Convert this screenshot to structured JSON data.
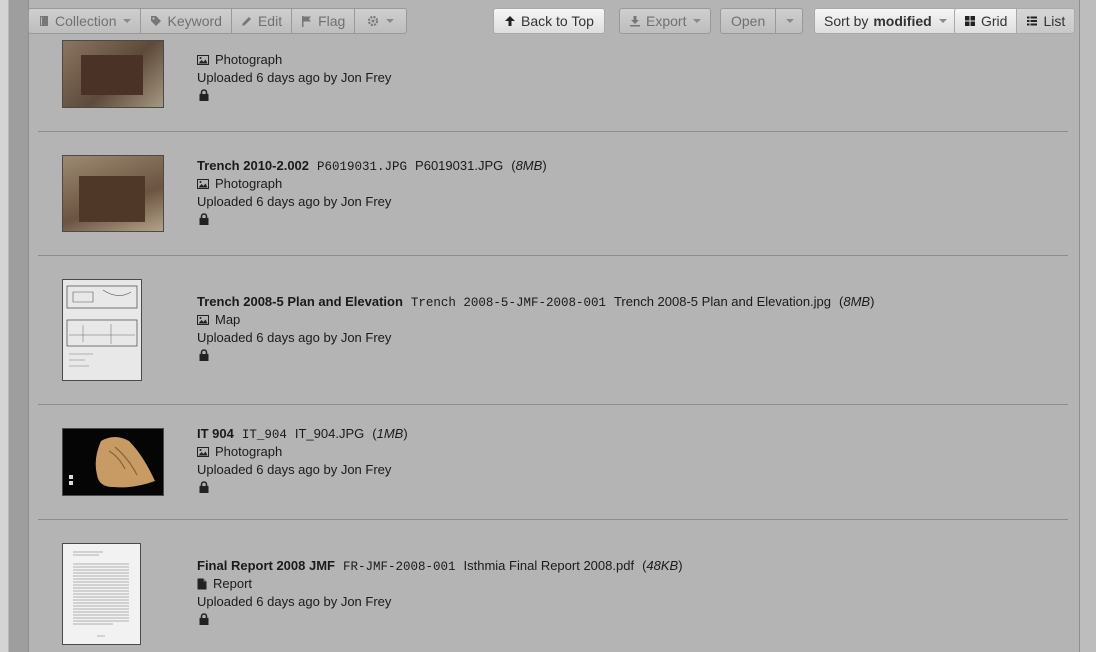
{
  "toolbar": {
    "collection_label": "Collection",
    "keyword_label": "Keyword",
    "edit_label": "Edit",
    "flag_label": "Flag",
    "back_to_top_label": "Back to Top",
    "export_label": "Export",
    "open_label": "Open",
    "sort_prefix": "Sort by",
    "sort_value": "modified",
    "grid_label": "Grid",
    "list_label": "List"
  },
  "items": [
    {
      "type": "Photograph",
      "uploaded": "Uploaded 6 days ago by Jon Frey",
      "thumb_icon": "trench-photo"
    },
    {
      "title": "Trench 2010-2.002",
      "code": "P6019031.JPG",
      "filename": "P6019031.JPG",
      "size": "8MB",
      "type": "Photograph",
      "uploaded": "Uploaded 6 days ago by Jon Frey",
      "thumb_icon": "trench-photo"
    },
    {
      "title": "Trench 2008-5 Plan and Elevation",
      "code": "Trench 2008-5-JMF-2008-001",
      "filename": "Trench 2008-5 Plan and Elevation.jpg",
      "size": "8MB",
      "type": "Map",
      "uploaded": "Uploaded 6 days ago by Jon Frey",
      "thumb_icon": "plan-drawing"
    },
    {
      "title": "IT 904",
      "code": "IT_904",
      "filename": "IT_904.JPG",
      "size": "1MB",
      "type": "Photograph",
      "uploaded": "Uploaded 6 days ago by Jon Frey",
      "thumb_icon": "artifact-photo"
    },
    {
      "title": "Final Report 2008 JMF",
      "code": "FR-JMF-2008-001",
      "filename": "Isthmia Final Report 2008.pdf",
      "size": "48KB",
      "type": "Report",
      "uploaded": "Uploaded 6 days ago by Jon Frey",
      "thumb_icon": "document-page"
    }
  ]
}
